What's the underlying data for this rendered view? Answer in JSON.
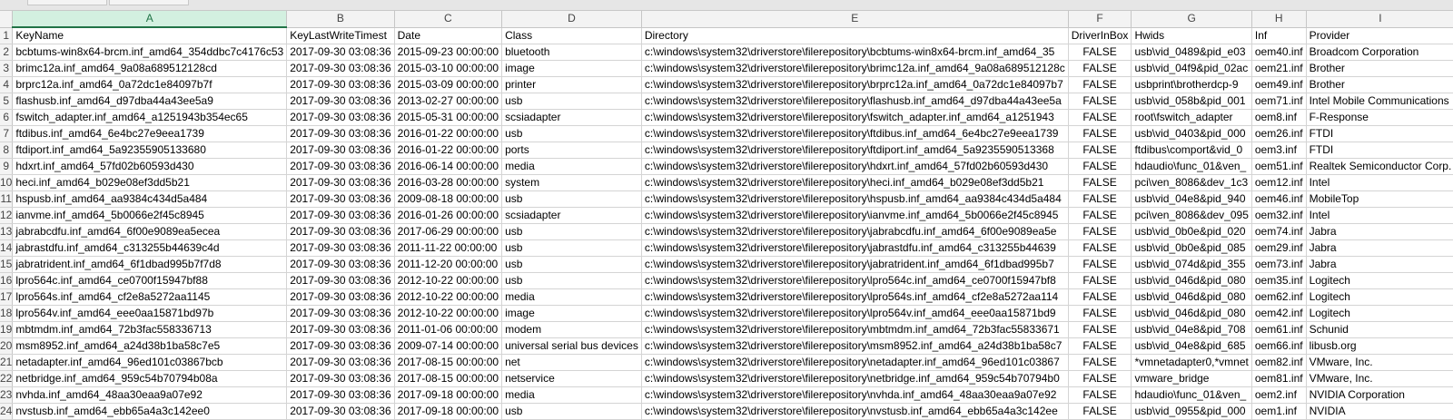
{
  "columns": [
    "A",
    "B",
    "C",
    "D",
    "E",
    "F",
    "G",
    "H",
    "I"
  ],
  "selected_column": "A",
  "row_numbers": [
    "1",
    "2",
    "3",
    "4",
    "5",
    "6",
    "7",
    "8",
    "9",
    "10",
    "11",
    "12",
    "13",
    "14",
    "15",
    "16",
    "17",
    "18",
    "19",
    "20",
    "21",
    "22",
    "23",
    "24"
  ],
  "header_row": [
    "KeyName",
    "KeyLastWriteTimest",
    "Date",
    "Class",
    "Directory",
    "DriverInBox",
    "Hwids",
    "Inf",
    "Provider"
  ],
  "rows": [
    [
      "bcbtums-win8x64-brcm.inf_amd64_354ddbc7c4176c53",
      "2017-09-30 03:08:36",
      "2015-09-23 00:00:00",
      "bluetooth",
      "c:\\windows\\system32\\driverstore\\filerepository\\bcbtums-win8x64-brcm.inf_amd64_35",
      "FALSE",
      "usb\\vid_0489&pid_e03",
      "oem40.inf",
      "Broadcom Corporation"
    ],
    [
      "brimc12a.inf_amd64_9a08a689512128cd",
      "2017-09-30 03:08:36",
      "2015-03-10 00:00:00",
      "image",
      "c:\\windows\\system32\\driverstore\\filerepository\\brimc12a.inf_amd64_9a08a689512128c",
      "FALSE",
      "usb\\vid_04f9&pid_02ac",
      "oem21.inf",
      "Brother"
    ],
    [
      "brprc12a.inf_amd64_0a72dc1e84097b7f",
      "2017-09-30 03:08:36",
      "2015-03-09 00:00:00",
      "printer",
      "c:\\windows\\system32\\driverstore\\filerepository\\brprc12a.inf_amd64_0a72dc1e84097b7",
      "FALSE",
      "usbprint\\brotherdcp-9",
      "oem49.inf",
      "Brother"
    ],
    [
      "flashusb.inf_amd64_d97dba44a43ee5a9",
      "2017-09-30 03:08:36",
      "2013-02-27 00:00:00",
      "usb",
      "c:\\windows\\system32\\driverstore\\filerepository\\flashusb.inf_amd64_d97dba44a43ee5a",
      "FALSE",
      "usb\\vid_058b&pid_001",
      "oem71.inf",
      "Intel Mobile Communications"
    ],
    [
      "fswitch_adapter.inf_amd64_a1251943b354ec65",
      "2017-09-30 03:08:36",
      "2015-05-31 00:00:00",
      "scsiadapter",
      "c:\\windows\\system32\\driverstore\\filerepository\\fswitch_adapter.inf_amd64_a1251943",
      "FALSE",
      "root\\fswitch_adapter",
      "oem8.inf",
      "F-Response"
    ],
    [
      "ftdibus.inf_amd64_6e4bc27e9eea1739",
      "2017-09-30 03:08:36",
      "2016-01-22 00:00:00",
      "usb",
      "c:\\windows\\system32\\driverstore\\filerepository\\ftdibus.inf_amd64_6e4bc27e9eea1739",
      "FALSE",
      "usb\\vid_0403&pid_000",
      "oem26.inf",
      "FTDI"
    ],
    [
      "ftdiport.inf_amd64_5a92355905133680",
      "2017-09-30 03:08:36",
      "2016-01-22 00:00:00",
      "ports",
      "c:\\windows\\system32\\driverstore\\filerepository\\ftdiport.inf_amd64_5a9235590513368",
      "FALSE",
      "ftdibus\\comport&vid_0",
      "oem3.inf",
      "FTDI"
    ],
    [
      "hdxrt.inf_amd64_57fd02b60593d430",
      "2017-09-30 03:08:36",
      "2016-06-14 00:00:00",
      "media",
      "c:\\windows\\system32\\driverstore\\filerepository\\hdxrt.inf_amd64_57fd02b60593d430",
      "FALSE",
      "hdaudio\\func_01&ven_",
      "oem51.inf",
      "Realtek Semiconductor Corp."
    ],
    [
      "heci.inf_amd64_b029e08ef3dd5b21",
      "2017-09-30 03:08:36",
      "2016-03-28 00:00:00",
      "system",
      "c:\\windows\\system32\\driverstore\\filerepository\\heci.inf_amd64_b029e08ef3dd5b21",
      "FALSE",
      "pci\\ven_8086&dev_1c3",
      "oem12.inf",
      "Intel"
    ],
    [
      "hspusb.inf_amd64_aa9384c434d5a484",
      "2017-09-30 03:08:36",
      "2009-08-18 00:00:00",
      "usb",
      "c:\\windows\\system32\\driverstore\\filerepository\\hspusb.inf_amd64_aa9384c434d5a484",
      "FALSE",
      "usb\\vid_04e8&pid_940",
      "oem46.inf",
      "MobileTop"
    ],
    [
      "ianvme.inf_amd64_5b0066e2f45c8945",
      "2017-09-30 03:08:36",
      "2016-01-26 00:00:00",
      "scsiadapter",
      "c:\\windows\\system32\\driverstore\\filerepository\\ianvme.inf_amd64_5b0066e2f45c8945",
      "FALSE",
      "pci\\ven_8086&dev_095",
      "oem32.inf",
      "Intel"
    ],
    [
      "jabrabcdfu.inf_amd64_6f00e9089ea5ecea",
      "2017-09-30 03:08:36",
      "2017-06-29 00:00:00",
      "usb",
      "c:\\windows\\system32\\driverstore\\filerepository\\jabrabcdfu.inf_amd64_6f00e9089ea5e",
      "FALSE",
      "usb\\vid_0b0e&pid_020",
      "oem74.inf",
      "Jabra"
    ],
    [
      "jabrastdfu.inf_amd64_c313255b44639c4d",
      "2017-09-30 03:08:36",
      "2011-11-22 00:00:00",
      "usb",
      "c:\\windows\\system32\\driverstore\\filerepository\\jabrastdfu.inf_amd64_c313255b44639",
      "FALSE",
      "usb\\vid_0b0e&pid_085",
      "oem29.inf",
      "Jabra"
    ],
    [
      "jabratrident.inf_amd64_6f1dbad995b7f7d8",
      "2017-09-30 03:08:36",
      "2011-12-20 00:00:00",
      "usb",
      "c:\\windows\\system32\\driverstore\\filerepository\\jabratrident.inf_amd64_6f1dbad995b7",
      "FALSE",
      "usb\\vid_074d&pid_355",
      "oem73.inf",
      "Jabra"
    ],
    [
      "lpro564c.inf_amd64_ce0700f15947bf88",
      "2017-09-30 03:08:36",
      "2012-10-22 00:00:00",
      "usb",
      "c:\\windows\\system32\\driverstore\\filerepository\\lpro564c.inf_amd64_ce0700f15947bf8",
      "FALSE",
      "usb\\vid_046d&pid_080",
      "oem35.inf",
      "Logitech"
    ],
    [
      "lpro564s.inf_amd64_cf2e8a5272aa1145",
      "2017-09-30 03:08:36",
      "2012-10-22 00:00:00",
      "media",
      "c:\\windows\\system32\\driverstore\\filerepository\\lpro564s.inf_amd64_cf2e8a5272aa114",
      "FALSE",
      "usb\\vid_046d&pid_080",
      "oem62.inf",
      "Logitech"
    ],
    [
      "lpro564v.inf_amd64_eee0aa15871bd97b",
      "2017-09-30 03:08:36",
      "2012-10-22 00:00:00",
      "image",
      "c:\\windows\\system32\\driverstore\\filerepository\\lpro564v.inf_amd64_eee0aa15871bd9",
      "FALSE",
      "usb\\vid_046d&pid_080",
      "oem42.inf",
      "Logitech"
    ],
    [
      "mbtmdm.inf_amd64_72b3fac558336713",
      "2017-09-30 03:08:36",
      "2011-01-06 00:00:00",
      "modem",
      "c:\\windows\\system32\\driverstore\\filerepository\\mbtmdm.inf_amd64_72b3fac55833671",
      "FALSE",
      "usb\\vid_04e8&pid_708",
      "oem61.inf",
      "Schunid"
    ],
    [
      "msm8952.inf_amd64_a24d38b1ba58c7e5",
      "2017-09-30 03:08:36",
      "2009-07-14 00:00:00",
      "universal serial bus devices",
      "c:\\windows\\system32\\driverstore\\filerepository\\msm8952.inf_amd64_a24d38b1ba58c7",
      "FALSE",
      "usb\\vid_04e8&pid_685",
      "oem66.inf",
      "libusb.org"
    ],
    [
      "netadapter.inf_amd64_96ed101c03867bcb",
      "2017-09-30 03:08:36",
      "2017-08-15 00:00:00",
      "net",
      "c:\\windows\\system32\\driverstore\\filerepository\\netadapter.inf_amd64_96ed101c03867",
      "FALSE",
      "*vmnetadapter0,*vmnet",
      "oem82.inf",
      "VMware, Inc."
    ],
    [
      "netbridge.inf_amd64_959c54b70794b08a",
      "2017-09-30 03:08:36",
      "2017-08-15 00:00:00",
      "netservice",
      "c:\\windows\\system32\\driverstore\\filerepository\\netbridge.inf_amd64_959c54b70794b0",
      "FALSE",
      "vmware_bridge",
      "oem81.inf",
      "VMware, Inc."
    ],
    [
      "nvhda.inf_amd64_48aa30eaa9a07e92",
      "2017-09-30 03:08:36",
      "2017-09-18 00:00:00",
      "media",
      "c:\\windows\\system32\\driverstore\\filerepository\\nvhda.inf_amd64_48aa30eaa9a07e92",
      "FALSE",
      "hdaudio\\func_01&ven_",
      "oem2.inf",
      "NVIDIA Corporation"
    ],
    [
      "nvstusb.inf_amd64_ebb65a4a3c142ee0",
      "2017-09-30 03:08:36",
      "2017-09-18 00:00:00",
      "usb",
      "c:\\windows\\system32\\driverstore\\filerepository\\nvstusb.inf_amd64_ebb65a4a3c142ee",
      "FALSE",
      "usb\\vid_0955&pid_000",
      "oem1.inf",
      "NVIDIA"
    ]
  ]
}
